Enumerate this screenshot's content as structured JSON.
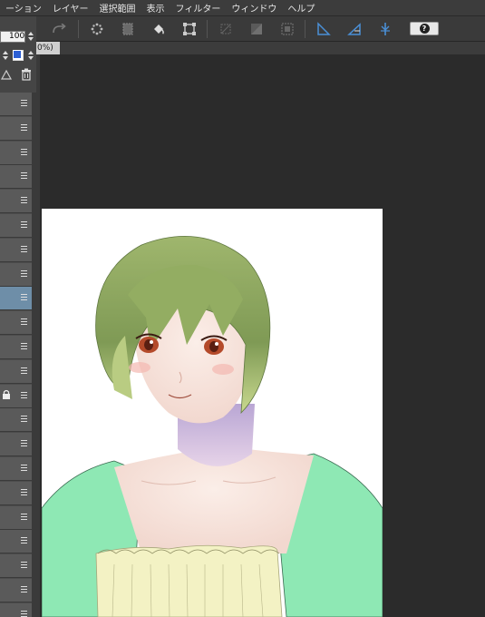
{
  "menu": {
    "items": [
      "ーション",
      "レイヤー",
      "選択範囲",
      "表示",
      "フィルター",
      "ウィンドウ",
      "ヘルプ"
    ]
  },
  "left_panel": {
    "opacity_value": "100",
    "layer_count_visible": 22,
    "selected_layer_index": 8,
    "locked_layer_index": 12
  },
  "toolbar": {
    "icons": [
      "redo-icon",
      "loading-icon",
      "select-stamp-icon",
      "fill-bucket-icon",
      "transform-icon",
      "deselect-icon",
      "invert-selection-icon",
      "border-selection-icon",
      "ruler-icon",
      "perspective-ruler-icon",
      "snap-icon",
      "help-icon"
    ],
    "help_label": "?"
  },
  "canvas": {
    "tab_label": "0%)"
  },
  "colors": {
    "menubar": "#3c3c3c",
    "workspace": "#2b2b2b",
    "paper": "#ffffff",
    "selected_layer": "#6e8ea8",
    "main_color": "#2c5fd3",
    "hair": "#8aa35a",
    "top": "#8ee8b4"
  }
}
